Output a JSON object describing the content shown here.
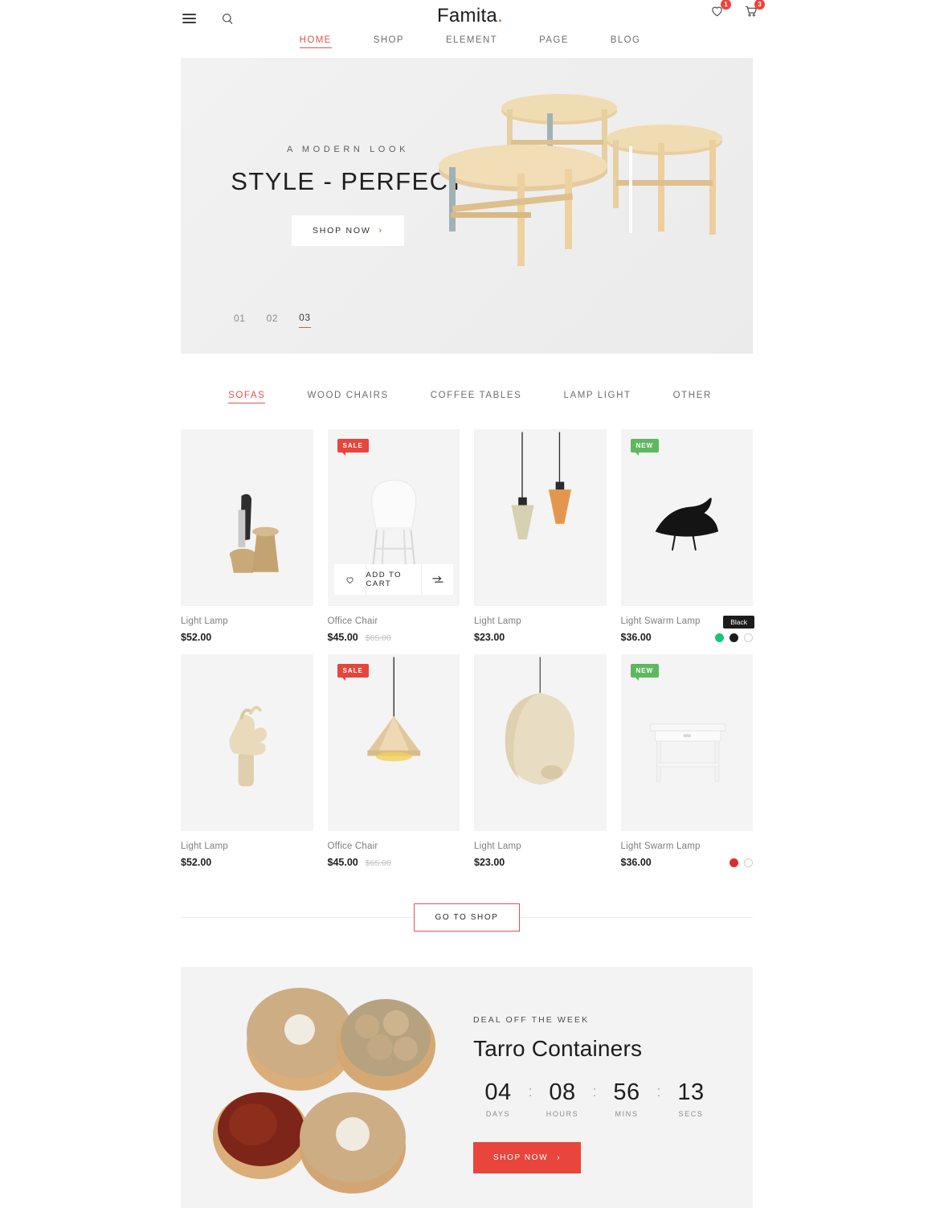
{
  "header": {
    "brand": "Famita",
    "brand_dot": ".",
    "menu_icon": "hamburger-menu-icon",
    "search_icon": "search-icon",
    "wishlist_icon": "heart-icon",
    "wishlist_count": "1",
    "cart_icon": "cart-icon",
    "cart_count": "3",
    "nav": [
      {
        "label": "HOME",
        "active": true
      },
      {
        "label": "SHOP",
        "active": false
      },
      {
        "label": "ELEMENT",
        "active": false
      },
      {
        "label": "PAGE",
        "active": false
      },
      {
        "label": "BLOG",
        "active": false
      }
    ]
  },
  "hero": {
    "subtitle": "A MODERN LOOK",
    "title": "STYLE - PERFECT",
    "button": "SHOP NOW",
    "button_chevron": "›",
    "slides": [
      {
        "label": "01",
        "active": false
      },
      {
        "label": "02",
        "active": false
      },
      {
        "label": "03",
        "active": true
      }
    ]
  },
  "category_tabs": [
    {
      "label": "SOFAS",
      "active": true
    },
    {
      "label": "WOOD CHAIRS",
      "active": false
    },
    {
      "label": "COFFEE TABLES",
      "active": false
    },
    {
      "label": "LAMP LIGHT",
      "active": false
    },
    {
      "label": "OTHER",
      "active": false
    }
  ],
  "products": [
    {
      "name": "Light Lamp",
      "price": "$52.00",
      "old_price": "",
      "badge": "",
      "badge_type": "",
      "art": "cork-vase",
      "hover_cart": false,
      "swatches": [],
      "tooltip": ""
    },
    {
      "name": "Office Chair",
      "price": "$45.00",
      "old_price": "$65.00",
      "badge": "SALE",
      "badge_type": "sale",
      "art": "white-chair",
      "hover_cart": true,
      "swatches": [],
      "tooltip": "",
      "cart_label": "ADD TO CART",
      "wish_icon": "heart-icon",
      "compare_icon": "compare-icon"
    },
    {
      "name": "Light Lamp",
      "price": "$23.00",
      "old_price": "",
      "badge": "",
      "badge_type": "",
      "art": "pendant-duo",
      "hover_cart": false,
      "swatches": [],
      "tooltip": ""
    },
    {
      "name": "Light Swarm Lamp",
      "price": "$36.00",
      "old_price": "",
      "badge": "NEW",
      "badge_type": "new",
      "art": "black-bird",
      "hover_cart": false,
      "swatches": [
        "#16c77a",
        "#1c1c1c",
        "#ffffff"
      ],
      "tooltip": "Black"
    },
    {
      "name": "Light Lamp",
      "price": "$52.00",
      "old_price": "",
      "badge": "",
      "badge_type": "",
      "art": "wood-hand",
      "hover_cart": false,
      "swatches": [],
      "tooltip": ""
    },
    {
      "name": "Office Chair",
      "price": "$45.00",
      "old_price": "$65.00",
      "badge": "SALE",
      "badge_type": "sale",
      "art": "cone-pendant",
      "hover_cart": false,
      "swatches": [],
      "tooltip": ""
    },
    {
      "name": "Light Lamp",
      "price": "$23.00",
      "old_price": "",
      "badge": "",
      "badge_type": "",
      "art": "hanging-chair",
      "hover_cart": false,
      "swatches": [],
      "tooltip": ""
    },
    {
      "name": "Light Swarm Lamp",
      "price": "$36.00",
      "old_price": "",
      "badge": "NEW",
      "badge_type": "new",
      "art": "white-desk",
      "hover_cart": false,
      "swatches": [
        "#e02b2b",
        "#ffffff"
      ],
      "tooltip": ""
    }
  ],
  "go_to_shop": "GO TO SHOP",
  "deal": {
    "kicker": "DEAL OFF THE WEEK",
    "title": "Tarro Containers",
    "timer": [
      {
        "value": "04",
        "label": "DAYS"
      },
      {
        "value": "08",
        "label": "HOURS"
      },
      {
        "value": "56",
        "label": "MINS"
      },
      {
        "value": "13",
        "label": "SECS"
      }
    ],
    "separator": ":",
    "button": "SHOP NOW",
    "button_chevron": "›"
  },
  "colors": {
    "accent": "#e05252",
    "red": "#e8453c",
    "green": "#5fb85f",
    "tile": "#f4f4f4"
  }
}
